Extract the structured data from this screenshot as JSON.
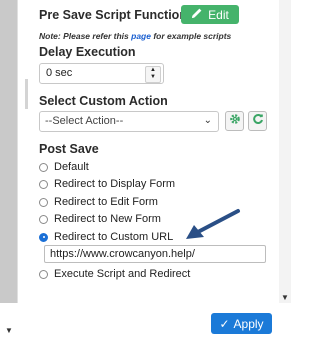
{
  "pre_save": {
    "label": "Pre Save Script Function",
    "edit_label": "Edit",
    "note_prefix": "Note: Please refer this ",
    "note_link": "page",
    "note_suffix": " for example scripts"
  },
  "delay": {
    "label": "Delay Execution",
    "value": "0 sec"
  },
  "custom_action": {
    "label": "Select Custom Action",
    "selected": "--Select Action--"
  },
  "post_save": {
    "label": "Post Save",
    "options": [
      {
        "label": "Default",
        "checked": false
      },
      {
        "label": "Redirect to Display Form",
        "checked": false
      },
      {
        "label": "Redirect to Edit Form",
        "checked": false
      },
      {
        "label": "Redirect to New Form",
        "checked": false
      },
      {
        "label": "Redirect to Custom URL",
        "checked": true
      },
      {
        "label": "Execute Script and Redirect",
        "checked": false
      }
    ],
    "custom_url": "https://www.crowcanyon.help/"
  },
  "apply_label": "Apply",
  "colors": {
    "edit_green": "#45b36b",
    "apply_blue": "#1b7ad8",
    "link_blue": "#1a5fd0",
    "arrow_navy": "#2a4f86"
  }
}
